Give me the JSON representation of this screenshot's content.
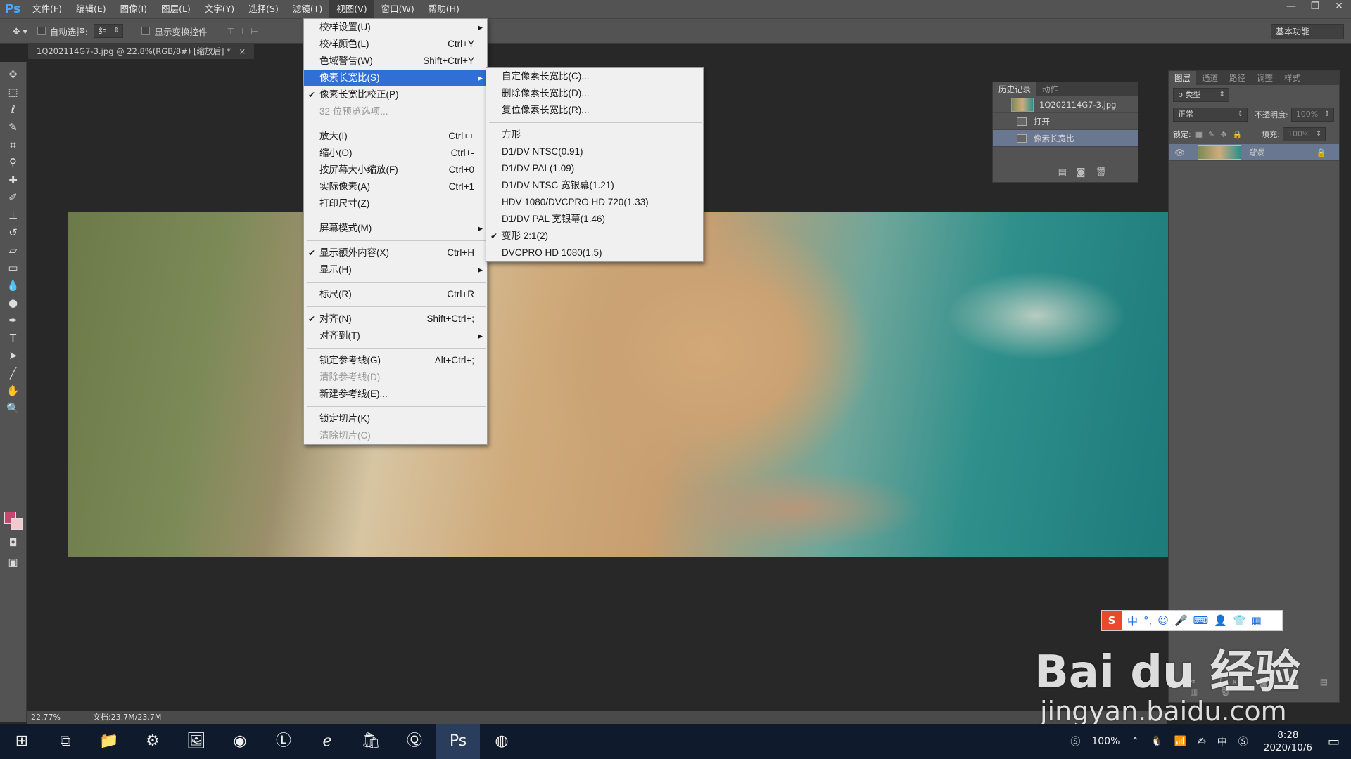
{
  "app": {
    "logo": "Ps",
    "menus": [
      "文件(F)",
      "编辑(E)",
      "图像(I)",
      "图层(L)",
      "文字(Y)",
      "选择(S)",
      "滤镜(T)",
      "视图(V)",
      "窗口(W)",
      "帮助(H)"
    ],
    "active_menu_index": 7,
    "window_buttons": [
      "—",
      "❐",
      "✕"
    ]
  },
  "options_bar": {
    "auto_select_label": "自动选择:",
    "auto_select_value": "组",
    "show_transform_label": "显示变换控件",
    "workspace": "基本功能"
  },
  "document": {
    "tab_title": "1Q202114G7-3.jpg @ 22.8%(RGB/8#) [缩放后] *",
    "tab_close": "×"
  },
  "status": {
    "zoom": "22.77%",
    "doc_size": "文档:23.7M/23.7M"
  },
  "view_menu": {
    "items": [
      {
        "label": "校样设置(U)",
        "shortcut": "",
        "submenu": true
      },
      {
        "label": "校样颜色(L)",
        "shortcut": "Ctrl+Y"
      },
      {
        "label": "色域警告(W)",
        "shortcut": "Shift+Ctrl+Y"
      },
      {
        "label": "像素长宽比(S)",
        "shortcut": "",
        "submenu": true,
        "selected": true
      },
      {
        "label": "像素长宽比校正(P)",
        "shortcut": "",
        "checked": true
      },
      {
        "label": "32 位预览选项...",
        "shortcut": "",
        "disabled": true
      },
      {
        "sep": true
      },
      {
        "label": "放大(I)",
        "shortcut": "Ctrl++"
      },
      {
        "label": "缩小(O)",
        "shortcut": "Ctrl+-"
      },
      {
        "label": "按屏幕大小缩放(F)",
        "shortcut": "Ctrl+0"
      },
      {
        "label": "实际像素(A)",
        "shortcut": "Ctrl+1"
      },
      {
        "label": "打印尺寸(Z)",
        "shortcut": ""
      },
      {
        "sep": true
      },
      {
        "label": "屏幕模式(M)",
        "shortcut": "",
        "submenu": true
      },
      {
        "sep": true
      },
      {
        "label": "显示额外内容(X)",
        "shortcut": "Ctrl+H",
        "checked": true
      },
      {
        "label": "显示(H)",
        "shortcut": "",
        "submenu": true
      },
      {
        "sep": true
      },
      {
        "label": "标尺(R)",
        "shortcut": "Ctrl+R"
      },
      {
        "sep": true
      },
      {
        "label": "对齐(N)",
        "shortcut": "Shift+Ctrl+;",
        "checked": true
      },
      {
        "label": "对齐到(T)",
        "shortcut": "",
        "submenu": true
      },
      {
        "sep": true
      },
      {
        "label": "锁定参考线(G)",
        "shortcut": "Alt+Ctrl+;"
      },
      {
        "label": "清除参考线(D)",
        "shortcut": "",
        "disabled": true
      },
      {
        "label": "新建参考线(E)...",
        "shortcut": ""
      },
      {
        "sep": true
      },
      {
        "label": "锁定切片(K)",
        "shortcut": ""
      },
      {
        "label": "清除切片(C)",
        "shortcut": "",
        "disabled": true
      }
    ]
  },
  "aspect_submenu": {
    "items": [
      {
        "label": "自定像素长宽比(C)..."
      },
      {
        "label": "删除像素长宽比(D)..."
      },
      {
        "label": "复位像素长宽比(R)..."
      },
      {
        "sep": true
      },
      {
        "label": "方形"
      },
      {
        "label": "D1/DV NTSC(0.91)"
      },
      {
        "label": "D1/DV PAL(1.09)"
      },
      {
        "label": "D1/DV NTSC 宽银幕(1.21)"
      },
      {
        "label": "HDV 1080/DVCPRO HD 720(1.33)"
      },
      {
        "label": "D1/DV PAL 宽银幕(1.46)"
      },
      {
        "label": "变形 2:1(2)",
        "checked": true
      },
      {
        "label": "DVCPRO HD 1080(1.5)"
      }
    ]
  },
  "history_panel": {
    "tabs": [
      "历史记录",
      "动作"
    ],
    "snapshot": "1Q202114G7-3.jpg",
    "steps": [
      "打开",
      "像素长宽比"
    ]
  },
  "layers_panel": {
    "tabs": [
      "图层",
      "通道",
      "路径",
      "调整",
      "样式"
    ],
    "filter": "ρ 类型",
    "blend_mode": "正常",
    "opacity_label": "不透明度:",
    "opacity": "100%",
    "lock_label": "锁定:",
    "fill_label": "填充:",
    "fill": "100%",
    "layer_name": "背景"
  },
  "taskbar": {
    "battery": "100%",
    "ime": "中",
    "time": "8:28",
    "date": "2020/10/6"
  },
  "ime_bar": {
    "logo": "S",
    "items": [
      "中",
      "°,",
      "☺",
      "🎤",
      "⌨",
      "👤",
      "👕",
      "▦"
    ]
  },
  "watermark": {
    "line1": "Bai du 经验",
    "line2": "jingyan.baidu.com"
  }
}
